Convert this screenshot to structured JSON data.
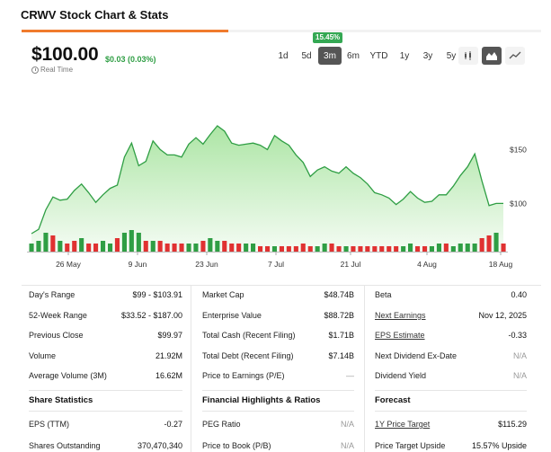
{
  "title": "CRWV Stock Chart & Stats",
  "quote": {
    "price": "$100.00",
    "change": "$0.03 (0.03%)",
    "realtime_label": "Real Time"
  },
  "range": {
    "options": [
      "1d",
      "5d",
      "3m",
      "6m",
      "YTD",
      "1y",
      "3y",
      "5y"
    ],
    "selected": "3m",
    "selected_change": "15.45%"
  },
  "chart_type_buttons": [
    "candlestick-icon",
    "mountain-chart-icon",
    "line-chart-icon"
  ],
  "chart_type_selected": "mountain-chart-icon",
  "colors": {
    "up": "#2f9e44",
    "down": "#e03131",
    "area_top": "#a8e4a0",
    "line": "#2f9e44",
    "accent": "#f07b2d"
  },
  "chart_data": {
    "type": "area",
    "x_ticks": [
      "26 May",
      "9 Jun",
      "23 Jun",
      "7 Jul",
      "21 Jul",
      "4 Aug",
      "18 Aug"
    ],
    "y_ticks": [
      "$150",
      "$100"
    ],
    "y_tick_values": [
      150,
      100
    ],
    "ylim": [
      62,
      172
    ],
    "series": [
      {
        "values": [
          72,
          76,
          94,
          106,
          103,
          104,
          112,
          118,
          110,
          101,
          108,
          114,
          117,
          143,
          156,
          135,
          139,
          158,
          150,
          145,
          145,
          143,
          155,
          161,
          155,
          164,
          172,
          167,
          156,
          154,
          155,
          156,
          154,
          150,
          163,
          158,
          154,
          145,
          138,
          125,
          131,
          134,
          130,
          128,
          134,
          128,
          124,
          118,
          110,
          108,
          105,
          99,
          104,
          111,
          105,
          101,
          102,
          108,
          108,
          116,
          126,
          134,
          146,
          121,
          98,
          100,
          100
        ]
      }
    ],
    "volume_bars": [
      3,
      4,
      7,
      6,
      4,
      3,
      4,
      5,
      3,
      3,
      4,
      3,
      5,
      7,
      8,
      7,
      4,
      4,
      4,
      3,
      3,
      3,
      3,
      3,
      4,
      5,
      4,
      4,
      3,
      3,
      3,
      3,
      2,
      2,
      2,
      2,
      2,
      2,
      3,
      2,
      2,
      3,
      3,
      2,
      2,
      2,
      2,
      2,
      2,
      2,
      2,
      2,
      2,
      3,
      2,
      2,
      2,
      3,
      3,
      2,
      3,
      3,
      3,
      5,
      6,
      7,
      3
    ],
    "volume_up": [
      1,
      1,
      1,
      0,
      1,
      0,
      0,
      1,
      0,
      0,
      1,
      1,
      0,
      1,
      1,
      1,
      0,
      1,
      0,
      0,
      0,
      0,
      1,
      1,
      0,
      1,
      1,
      0,
      0,
      0,
      1,
      1,
      0,
      0,
      1,
      0,
      0,
      0,
      0,
      0,
      1,
      1,
      0,
      0,
      1,
      0,
      0,
      0,
      0,
      0,
      0,
      0,
      1,
      1,
      0,
      0,
      1,
      1,
      0,
      1,
      1,
      1,
      1,
      0,
      0,
      1,
      0
    ]
  },
  "stats": {
    "col1": [
      {
        "label": "Day's Range",
        "value": "$99 - $103.91"
      },
      {
        "label": "52-Week Range",
        "value": "$33.52 - $187.00"
      },
      {
        "label": "Previous Close",
        "value": "$99.97"
      },
      {
        "label": "Volume",
        "value": "21.92M"
      },
      {
        "label": "Average Volume (3M)",
        "value": "16.62M"
      }
    ],
    "col2": [
      {
        "label": "Market Cap",
        "value": "$48.74B"
      },
      {
        "label": "Enterprise Value",
        "value": "$88.72B"
      },
      {
        "label": "Total Cash (Recent Filing)",
        "value": "$1.71B"
      },
      {
        "label": "Total Debt (Recent Filing)",
        "value": "$7.14B"
      },
      {
        "label": "Price to Earnings (P/E)",
        "value": "—"
      }
    ],
    "col3": [
      {
        "label": "Beta",
        "value": "0.40"
      },
      {
        "label": "Next Earnings",
        "value": "Nov 12, 2025"
      },
      {
        "label": "EPS Estimate",
        "value": "-0.33"
      },
      {
        "label": "Next Dividend Ex-Date",
        "value": "N/A"
      },
      {
        "label": "Dividend Yield",
        "value": "N/A"
      }
    ],
    "section1": {
      "heading": "Share Statistics",
      "rows": [
        {
          "label": "EPS (TTM)",
          "value": "-0.27"
        },
        {
          "label": "Shares Outstanding",
          "value": "370,470,340"
        }
      ]
    },
    "section2": {
      "heading": "Financial Highlights & Ratios",
      "rows": [
        {
          "label": "PEG Ratio",
          "value": "N/A"
        },
        {
          "label": "Price to Book (P/B)",
          "value": "N/A"
        }
      ]
    },
    "section3": {
      "heading": "Forecast",
      "rows": [
        {
          "label": "1Y Price Target",
          "value": "$115.29"
        },
        {
          "label": "Price Target Upside",
          "value": "15.57% Upside"
        }
      ]
    }
  }
}
